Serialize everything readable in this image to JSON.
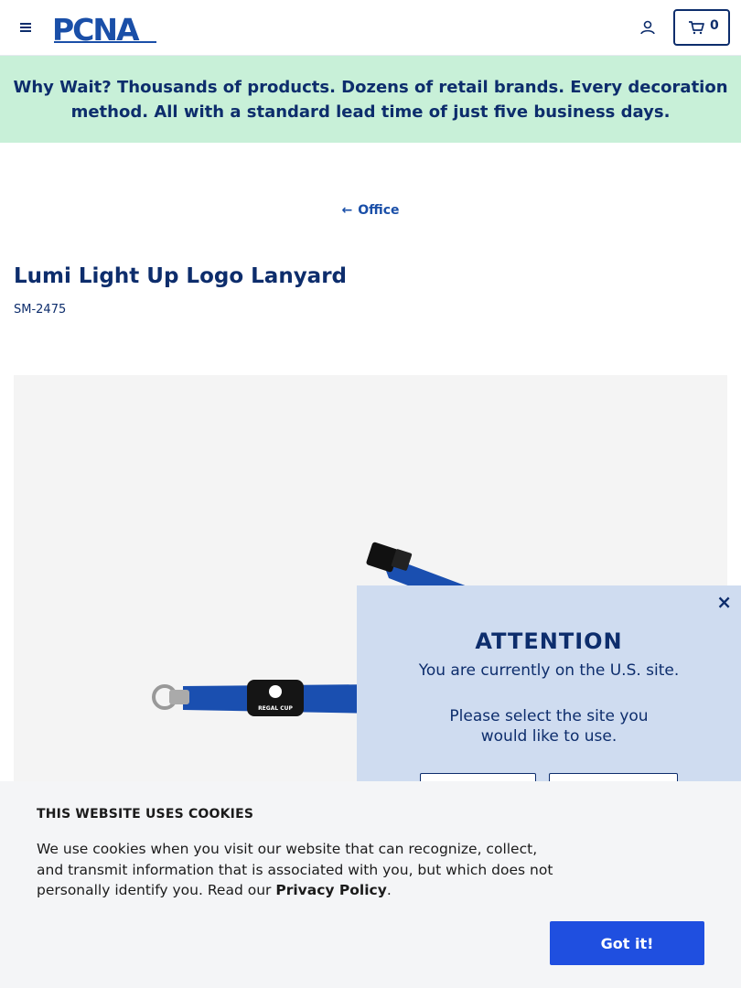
{
  "header": {
    "logo_text": "PCNA",
    "cart_count": "0"
  },
  "promo": {
    "lead": "Why Wait?",
    "message": " Thousands of products. Dozens of retail brands. Every decoration method. All with a standard lead time of just five business days."
  },
  "breadcrumb": {
    "back_label": "Office"
  },
  "product": {
    "title": "Lumi Light Up Logo Lanyard",
    "sku": "SM-2475",
    "image_badge_text": "REGAL CUP",
    "lanyard_color": "#1a4fb0"
  },
  "site_modal": {
    "title": "ATTENTION",
    "line1": "You are currently on the U.S. site.",
    "line2": "Please select the site you would like to use.",
    "close": "×"
  },
  "cookies": {
    "title": "THIS WEBSITE USES COOKIES",
    "text": "We use cookies when you visit our website that can recognize, collect, and transmit information that is associated with you, but which does not personally identify you. Read our ",
    "link": "Privacy Policy",
    "end": ".",
    "accept_label": "Got it!"
  },
  "colors": {
    "brand_navy": "#0d2d6c",
    "promo_bg": "#c8f0d8",
    "modal_bg": "#cfdcf0",
    "accept_button": "#1f4fe0"
  }
}
